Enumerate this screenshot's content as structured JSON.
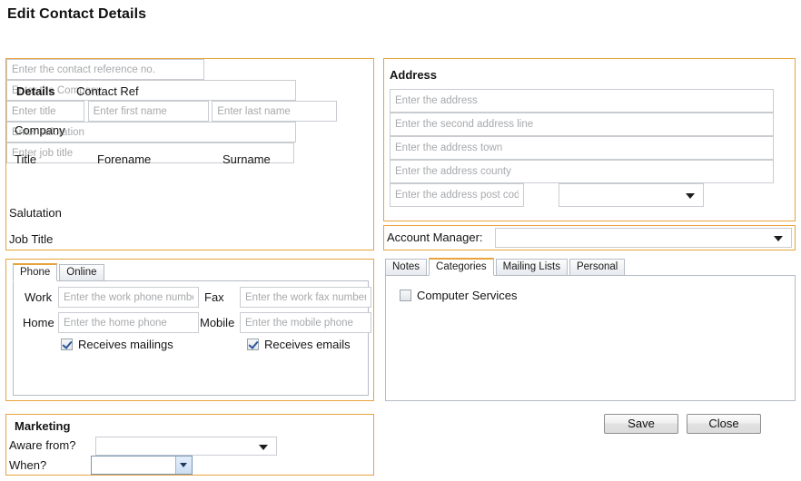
{
  "page": {
    "title": "Edit Contact Details"
  },
  "theme": {
    "panel_border": "#e8a33d",
    "field_border": "#c9ccd1",
    "placeholder": "#a7a9ac",
    "tab_active_accent": "#e8a33d",
    "check_color": "#2a5699"
  },
  "details_panel": {
    "title": "Details",
    "contact_ref": {
      "label": "Contact Ref",
      "value": "",
      "placeholder": "Enter the contact reference no."
    },
    "company": {
      "label": "Company",
      "value": "",
      "placeholder": "Enter the Company"
    },
    "title_field": {
      "label": "Title",
      "value": "",
      "placeholder": "Enter title"
    },
    "forename": {
      "label": "Forename",
      "value": "",
      "placeholder": "Enter first name"
    },
    "surname": {
      "label": "Surname",
      "value": "",
      "placeholder": "Enter last name"
    },
    "salutation": {
      "label": "Salutation",
      "value": "",
      "placeholder": "Enter salutation"
    },
    "job_title": {
      "label": "Job Title",
      "value": "",
      "placeholder": "Enter job title"
    }
  },
  "contact_tabs": {
    "tabs": [
      {
        "label": "Phone",
        "active": true
      },
      {
        "label": "Online",
        "active": false
      }
    ],
    "phone": {
      "work": {
        "label": "Work",
        "value": "",
        "placeholder": "Enter the work phone number"
      },
      "home": {
        "label": "Home",
        "value": "",
        "placeholder": "Enter the home phone"
      },
      "fax": {
        "label": "Fax",
        "value": "",
        "placeholder": "Enter the work fax number"
      },
      "mobile": {
        "label": "Mobile",
        "value": "",
        "placeholder": "Enter the mobile phone"
      },
      "receives_mailings": {
        "label": "Receives mailings",
        "checked": true
      },
      "receives_emails": {
        "label": "Receives emails",
        "checked": true
      }
    }
  },
  "marketing_panel": {
    "title": "Marketing",
    "aware_from": {
      "label": "Aware from?",
      "value": ""
    },
    "when": {
      "label": "When?",
      "value": ""
    }
  },
  "address_panel": {
    "title": "Address",
    "line1": {
      "value": "",
      "placeholder": "Enter the address"
    },
    "line2": {
      "value": "",
      "placeholder": "Enter the second address line"
    },
    "town": {
      "value": "",
      "placeholder": "Enter the address town"
    },
    "county": {
      "value": "",
      "placeholder": "Enter the address county"
    },
    "postcode": {
      "value": "",
      "placeholder": "Enter the address post code"
    },
    "country": {
      "value": ""
    }
  },
  "account_manager": {
    "label": "Account Manager:",
    "value": ""
  },
  "info_tabs": {
    "tabs": [
      {
        "label": "Notes",
        "active": false
      },
      {
        "label": "Categories",
        "active": true
      },
      {
        "label": "Mailing Lists",
        "active": false
      },
      {
        "label": "Personal",
        "active": false
      }
    ],
    "categories": [
      {
        "label": "Computer Services",
        "checked": false
      }
    ]
  },
  "actions": {
    "save": "Save",
    "close": "Close"
  }
}
